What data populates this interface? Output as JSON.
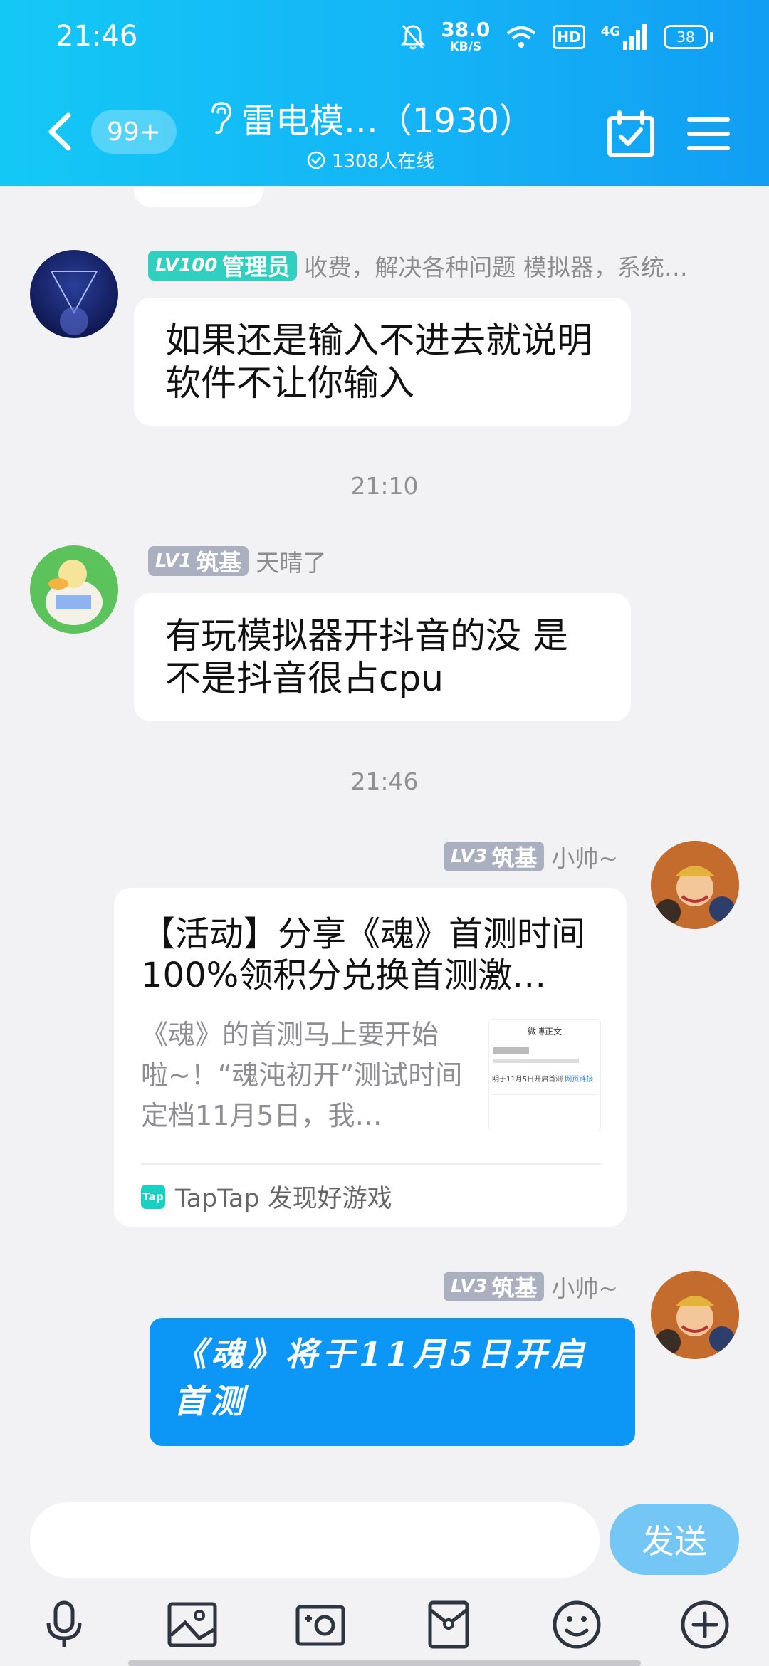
{
  "status_bar": {
    "time": "21:46",
    "net_speed_value": "38.0",
    "net_speed_unit": "KB/S",
    "hd": "HD",
    "network": "4G",
    "battery": "38"
  },
  "header": {
    "unread_count": "99+",
    "group_title": "雷电模…（1930）",
    "online_text": "1308人在线"
  },
  "messages": [
    {
      "level": "LV100",
      "role": "管理员",
      "name": "收费，解决各种问题 模拟器，系统…",
      "text": "如果还是输入不进去就说明软件不让你输入"
    },
    {
      "timestamp": "21:10"
    },
    {
      "level": "LV1",
      "role": "筑基",
      "name": "天晴了",
      "text": "有玩模拟器开抖音的没 是不是抖音很占cpu"
    },
    {
      "timestamp": "21:46"
    },
    {
      "level": "LV3",
      "role": "筑基",
      "name": "小帅~",
      "share": {
        "title": "【活动】分享《魂》首测时间 100%领积分兑换首测激…",
        "desc": "《魂》的首测马上要开始啦~！“魂沌初开”测试时间定档11月5日，我…",
        "thumb_title": "微博正文",
        "thumb_line1": "明于11月5日开启首测",
        "thumb_link": "网页链接",
        "source": "TapTap 发现好游戏",
        "source_icon": "Tap"
      }
    },
    {
      "level": "LV3",
      "role": "筑基",
      "name": "小帅~",
      "text": "《魂》将于11月5日开启首测"
    }
  ],
  "input": {
    "placeholder": "",
    "send_label": "发送"
  },
  "colors": {
    "header_gradient_start": "#14c8f6",
    "header_gradient_end": "#129ef3",
    "admin_badge": "#2fd0c0",
    "level_badge": "#aab0bf",
    "outgoing_bubble": "#0c97f7",
    "send_button": "#74c6f4"
  },
  "icons": [
    "back-icon",
    "ear-icon",
    "online-check-icon",
    "calendar-check-icon",
    "menu-icon",
    "mic-icon",
    "image-icon",
    "camera-icon",
    "red-packet-icon",
    "emoji-icon",
    "plus-icon"
  ]
}
